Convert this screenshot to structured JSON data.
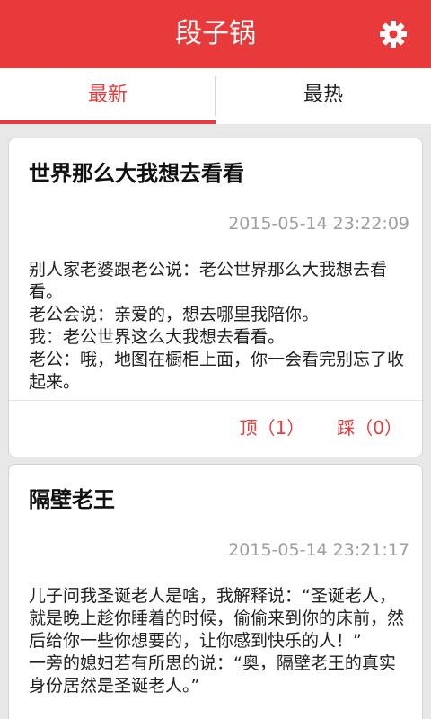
{
  "app": {
    "title": "段子锅"
  },
  "colors": {
    "accent": "#e83a3a",
    "header_text": "#ffffff",
    "timestamp": "#9e9e9e"
  },
  "icons": {
    "settings": "gear-icon"
  },
  "tabs": [
    {
      "label": "最新",
      "selected": true
    },
    {
      "label": "最热",
      "selected": false
    }
  ],
  "posts": [
    {
      "title": "世界那么大我想去看看",
      "time": "2015-05-14 23:22:09",
      "body": "别人家老婆跟老公说：老公世界那么大我想去看看。\n老公会说：亲爱的，想去哪里我陪你。\n我：老公世界这么大我想去看看。\n老公：哦，地图在橱柜上面，你一会看完别忘了收起来。",
      "up_label": "顶（1）",
      "down_label": "踩（0）"
    },
    {
      "title": "隔壁老王",
      "time": "2015-05-14 23:21:17",
      "body": "儿子问我圣诞老人是啥，我解释说：“圣诞老人，就是晚上趁你睡着的时候，偷偷来到你的床前，然后给你一些你想要的，让你感到快乐的人！”\n一旁的媳妇若有所思的说：“奥，隔壁老王的真实身份居然是圣诞老人。”"
    }
  ]
}
